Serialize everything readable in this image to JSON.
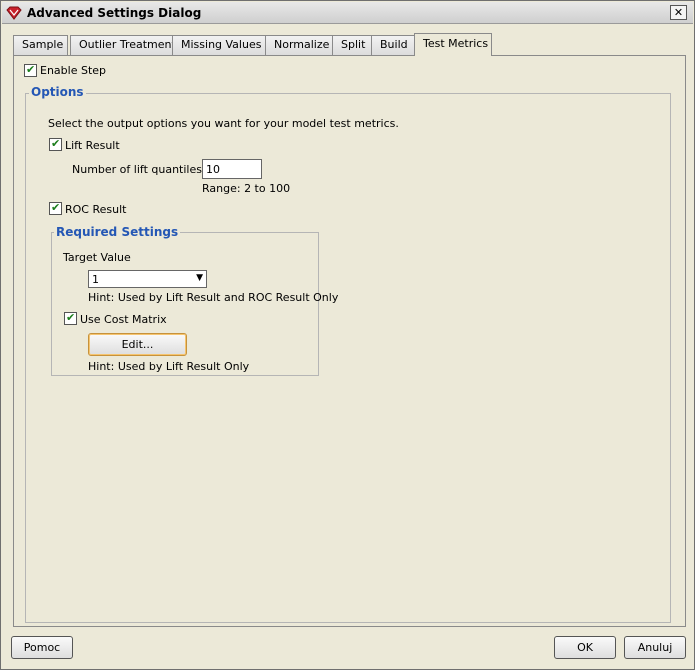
{
  "window": {
    "title": "Advanced Settings Dialog",
    "close_glyph": "✕"
  },
  "tabs": [
    {
      "label": "Sample"
    },
    {
      "label": "Outlier Treatment"
    },
    {
      "label": "Missing Values"
    },
    {
      "label": "Normalize"
    },
    {
      "label": "Split"
    },
    {
      "label": "Build"
    },
    {
      "label": "Test Metrics",
      "active": true
    }
  ],
  "enable_step": {
    "label": "Enable Step",
    "checked": true
  },
  "options": {
    "title": "Options",
    "description": "Select the output options you want for your model test metrics.",
    "lift_result": {
      "label": "Lift Result",
      "checked": true
    },
    "lift_quantiles": {
      "label": "Number of lift quantiles",
      "value": "10",
      "range": "Range: 2 to 100"
    },
    "roc_result": {
      "label": "ROC Result",
      "checked": true
    },
    "required": {
      "title": "Required Settings",
      "target_label": "Target Value",
      "target_value": "1",
      "target_hint": "Hint: Used by Lift Result and ROC Result Only",
      "cost_matrix": {
        "label": "Use Cost Matrix",
        "checked": true
      },
      "edit_label": "Edit...",
      "edit_hint": "Hint: Used by Lift Result Only"
    }
  },
  "footer": {
    "help_label": "Pomoc",
    "ok_label": "OK",
    "cancel_label": "Anuluj"
  }
}
